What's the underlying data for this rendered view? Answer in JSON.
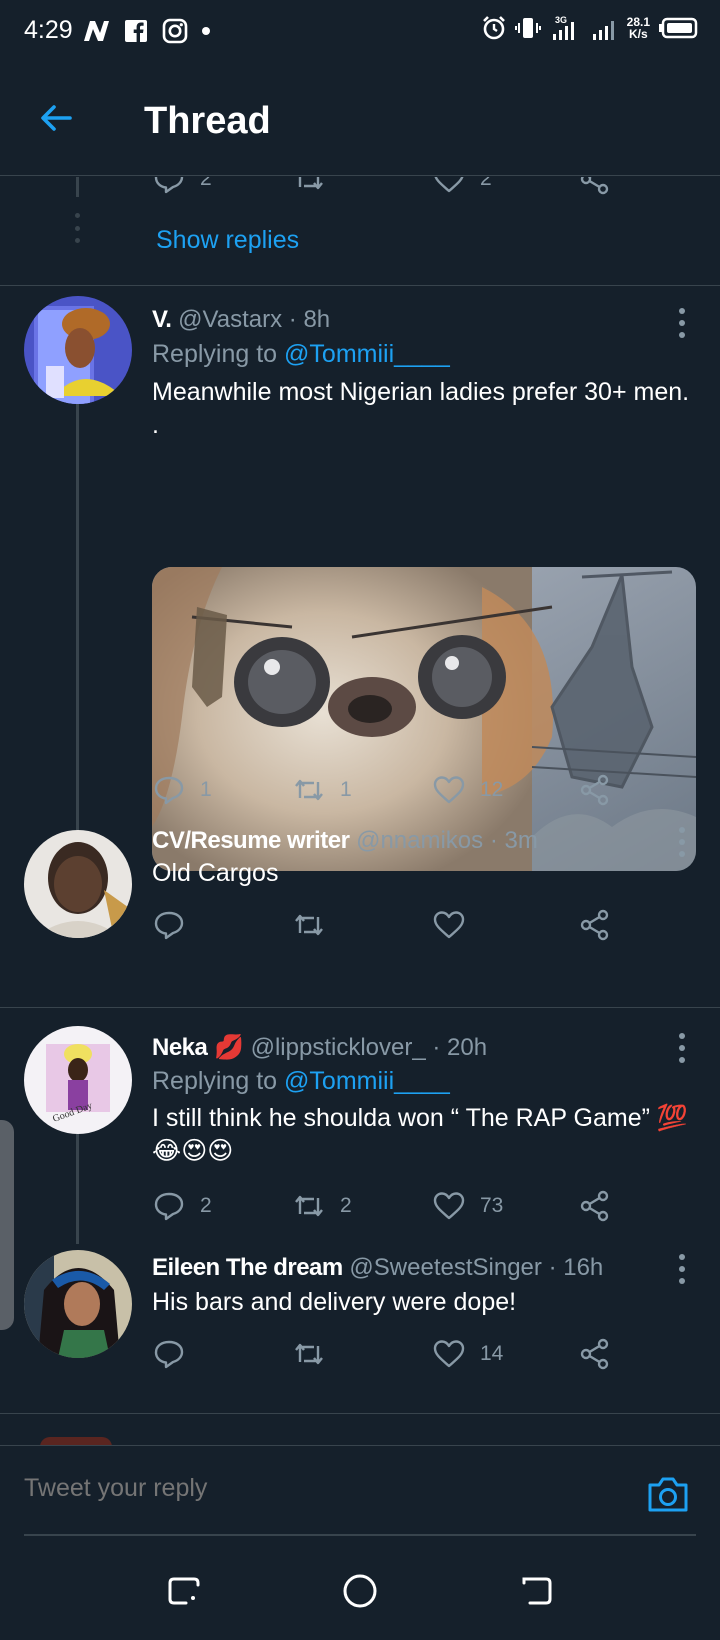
{
  "status_bar": {
    "time": "4:29",
    "network_speed_value": "28.1",
    "network_speed_unit": "K/s",
    "network_type": "3G",
    "icons": [
      "n-app-icon",
      "facebook-icon",
      "instagram-icon",
      "dot-icon",
      "alarm-icon",
      "vibrate-icon",
      "signal-icon",
      "signal-icon",
      "battery-icon"
    ]
  },
  "header": {
    "title": "Thread",
    "back_icon": "arrow-left-icon"
  },
  "colors": {
    "background": "#15202b",
    "accent": "#1da1f2",
    "muted": "#8899a6",
    "divider": "#38444d"
  },
  "prev_tweet": {
    "reply_count": "2",
    "like_count": "2",
    "show_replies": "Show replies"
  },
  "tweets": [
    {
      "name": "V.",
      "handle": "@Vastarx",
      "time": "· 8h",
      "replying_label": "Replying to",
      "replying_to": "@Tommiii____",
      "text": "Meanwhile most Nigerian ladies prefer 30+ men. .",
      "replies": "1",
      "retweets": "1",
      "likes": "12"
    },
    {
      "name": "CV/Resume writer",
      "handle": "@nnamikos",
      "time": "· 3m",
      "text": "Old Cargos",
      "replies": "",
      "retweets": "",
      "likes": ""
    },
    {
      "name": "Neka",
      "emoji_after_name": "💋",
      "handle": "@lippsticklover_",
      "time": "· 20h",
      "replying_label": "Replying to",
      "replying_to": "@Tommiii____",
      "text": "I still think he shoulda won “ The RAP Game” 💯 😂😍😍",
      "replies": "2",
      "retweets": "2",
      "likes": "73"
    },
    {
      "name": "Eileen The dream",
      "handle": "@SweetestSinger",
      "time": "· 16h",
      "text": "His bars and delivery were dope!",
      "replies": "",
      "retweets": "",
      "likes": "14"
    }
  ],
  "reply_bar": {
    "placeholder": "Tweet your reply",
    "camera_icon": "camera-icon"
  },
  "nav_bar": {
    "icons": [
      "recent-apps-icon",
      "home-icon",
      "back-icon"
    ]
  }
}
